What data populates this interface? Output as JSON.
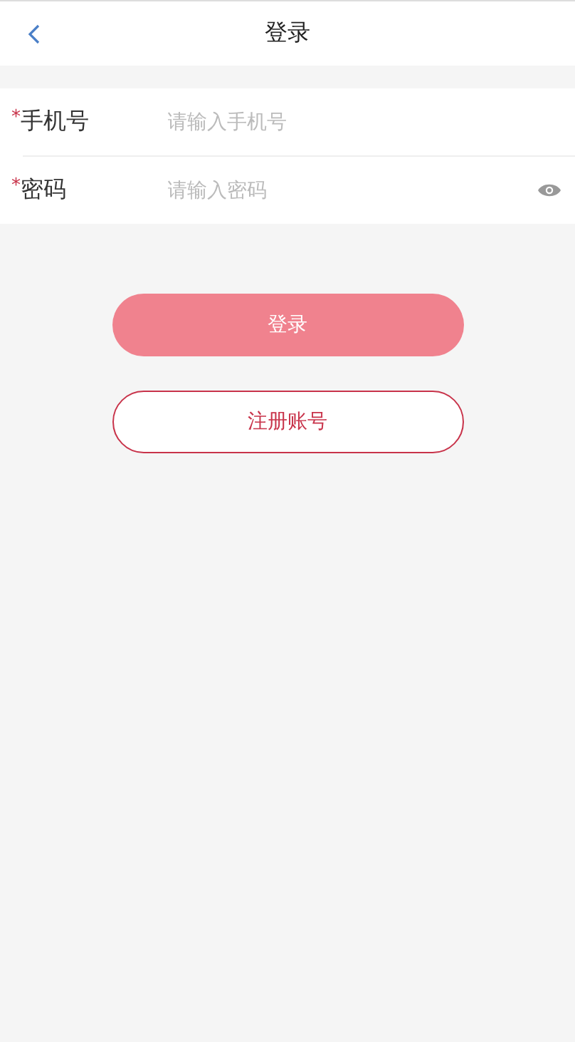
{
  "header": {
    "title": "登录"
  },
  "fields": [
    {
      "kind": "text",
      "required_mark": "*",
      "label": "手机号",
      "placeholder": "请输入手机号"
    },
    {
      "kind": "password",
      "required_mark": "*",
      "label": "密码",
      "placeholder": "请输入密码"
    }
  ],
  "login_button": {
    "label": "登录",
    "disabled": true
  },
  "register_button": {
    "label": "注册账号"
  }
}
